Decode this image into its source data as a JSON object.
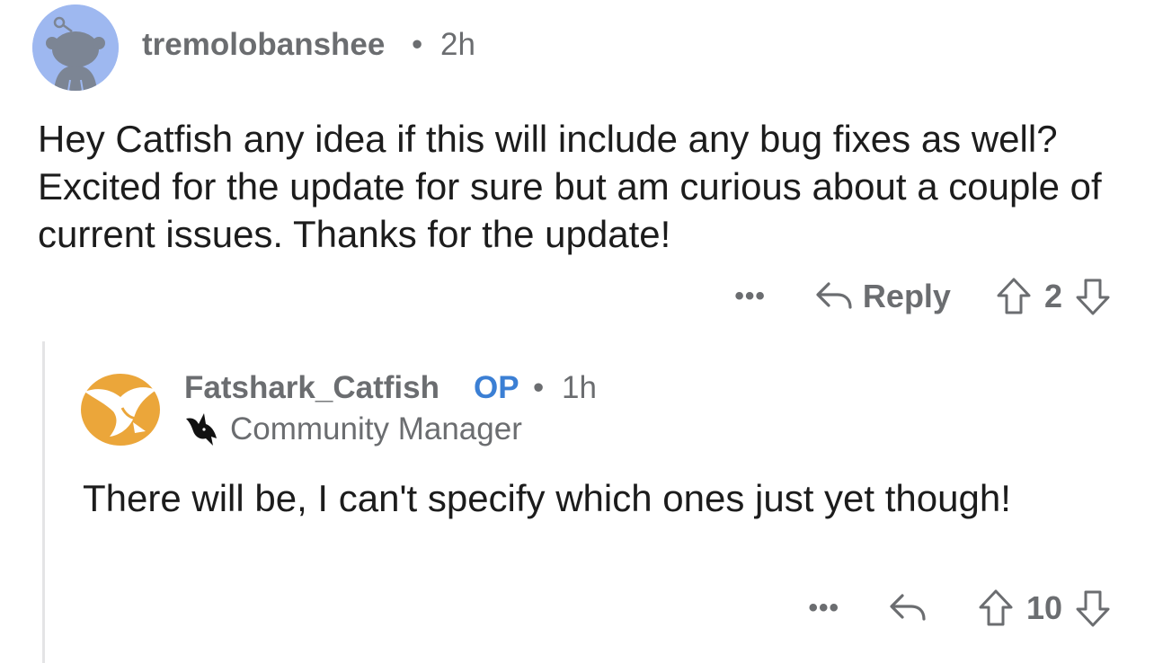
{
  "comment": {
    "username": "tremolobanshee",
    "separator": "•",
    "time": "2h",
    "body": "Hey Catfish any idea if this will include any bug fixes as well? Excited for the update for sure but am curious about a couple of current issues. Thanks for the update!",
    "more_label": "•••",
    "reply_label": "Reply",
    "vote_count": "2",
    "icons": {
      "avatar": "reddit-snoo-avatar-icon",
      "reply": "reply-arrow-icon",
      "upvote": "upvote-arrow-icon",
      "downvote": "downvote-arrow-icon"
    }
  },
  "reply": {
    "username": "Fatshark_Catfish",
    "op_badge": "OP",
    "separator": "•",
    "time": "1h",
    "flair": "Community Manager",
    "body": "There will be, I can't specify which ones just yet though!",
    "more_label": "•••",
    "vote_count": "10",
    "icons": {
      "avatar": "fatshark-logo-avatar-icon",
      "flair": "shark-flair-icon",
      "reply": "reply-arrow-icon",
      "upvote": "upvote-arrow-icon",
      "downvote": "downvote-arrow-icon"
    }
  },
  "colors": {
    "meta_gray": "#6b6d70",
    "op_blue": "#3b7fd4",
    "avatar_blue": "#9eb8f0",
    "fatshark_orange": "#eba63a"
  }
}
